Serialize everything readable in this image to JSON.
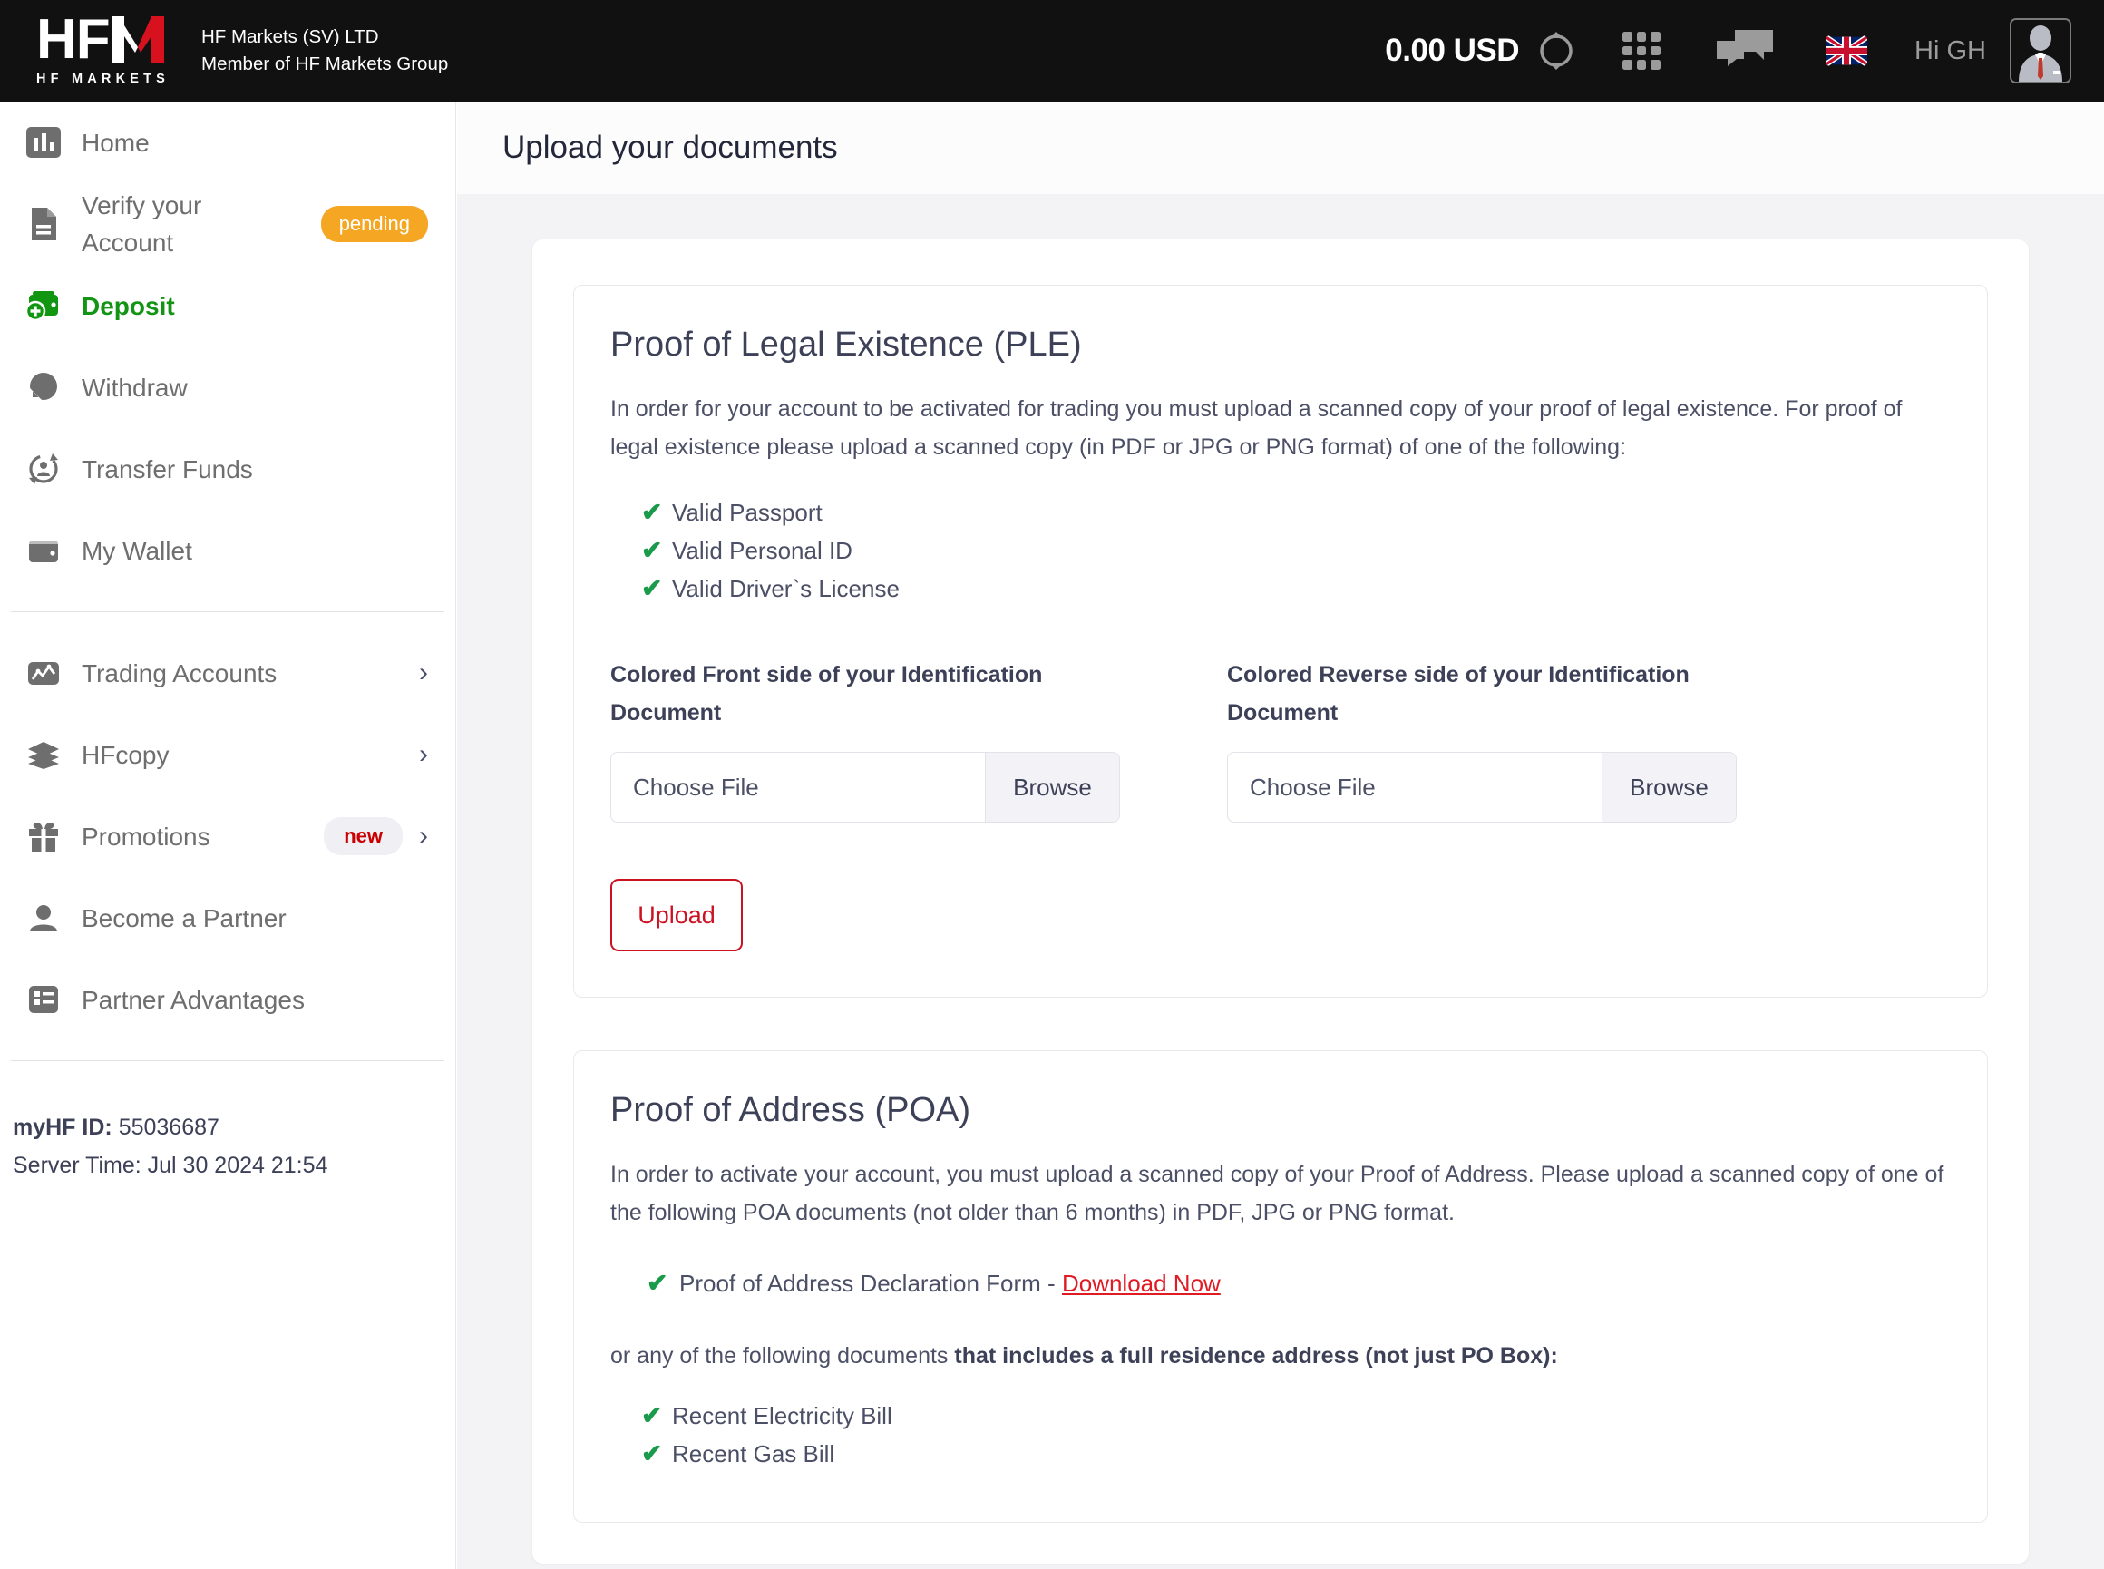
{
  "topbar": {
    "logo_letters": "HF",
    "logo_sub": "HF MARKETS",
    "company_line1": "HF Markets (SV) LTD",
    "company_line2": "Member of HF Markets Group",
    "balance": "0.00 USD",
    "refresh_icon": "refresh-icon",
    "apps_icon": "apps-grid-icon",
    "chat_icon": "chat-bubbles-icon",
    "flag_icon": "uk-flag-icon",
    "greeting": "Hi GH",
    "avatar_icon": "user-avatar-icon",
    "accent_red": "#cc1122",
    "bar_bg": "#111111"
  },
  "sidebar": {
    "items": [
      {
        "label": "Home",
        "icon": "chart-bars-icon",
        "badge": "",
        "chevron": false,
        "active": false
      },
      {
        "label": "Verify your Account",
        "icon": "document-icon",
        "badge": "pending",
        "badge_type": "pending",
        "chevron": false,
        "active": false
      },
      {
        "label": "Deposit",
        "icon": "deposit-wallet-icon",
        "badge": "",
        "chevron": false,
        "active": true
      },
      {
        "label": "Withdraw",
        "icon": "withdraw-pie-icon",
        "badge": "",
        "chevron": false,
        "active": false
      },
      {
        "label": "Transfer Funds",
        "icon": "transfer-funds-icon",
        "badge": "",
        "chevron": false,
        "active": false
      },
      {
        "label": "My Wallet",
        "icon": "wallet-icon",
        "badge": "",
        "chevron": false,
        "active": false
      }
    ],
    "items2": [
      {
        "label": "Trading Accounts",
        "icon": "trading-chart-icon",
        "badge": "",
        "chevron": true,
        "active": false
      },
      {
        "label": "HFcopy",
        "icon": "layers-icon",
        "badge": "",
        "chevron": true,
        "active": false
      },
      {
        "label": "Promotions",
        "icon": "gift-icon",
        "badge": "new",
        "badge_type": "new",
        "chevron": true,
        "active": false
      },
      {
        "label": "Become a Partner",
        "icon": "person-icon",
        "badge": "",
        "chevron": false,
        "active": false
      },
      {
        "label": "Partner Advantages",
        "icon": "list-icon",
        "badge": "",
        "chevron": false,
        "active": false
      }
    ],
    "footer": {
      "myhf_label": "myHF ID:",
      "myhf_value": "55036687",
      "server_time": "Server Time: Jul 30 2024 21:54"
    },
    "pending_color": "#f5a623",
    "active_color": "#149414",
    "new_color": "#cc0000"
  },
  "main": {
    "page_title": "Upload your documents",
    "ple": {
      "title": "Proof of Legal Existence (PLE)",
      "body": "In order for your account to be activated for trading you must upload a scanned copy of your proof of legal existence. For proof of legal existence please upload a scanned copy (in PDF or JPG or PNG format) of one of the following:",
      "accepted": [
        "Valid Passport",
        "Valid Personal ID",
        "Valid Driver`s License"
      ],
      "front_label": "Colored Front side of your Identification Document",
      "reverse_label": "Colored Reverse side of your Identification Document",
      "front_placeholder": "Choose File",
      "reverse_placeholder": "Choose File",
      "browse_label": "Browse",
      "browse_label2": "Browse",
      "upload_label": "Upload"
    },
    "poa": {
      "title": "Proof of Address (POA)",
      "body": "In order to activate your account, you must upload a scanned copy of your Proof of Address. Please upload a scanned copy of one of the following POA documents (not older than 6 months) in PDF, JPG or PNG format.",
      "declaration_text": "Proof of Address Declaration Form - ",
      "download_link": "Download Now",
      "or_line_plain": "or any of the following documents ",
      "or_line_bold": "that includes a full residence address (not just PO Box):",
      "documents": [
        "Recent Electricity Bill",
        "Recent Gas Bill"
      ]
    },
    "check_color": "#1a9a4b",
    "link_color": "#e01b24",
    "page_bg": "#f3f3f5"
  }
}
